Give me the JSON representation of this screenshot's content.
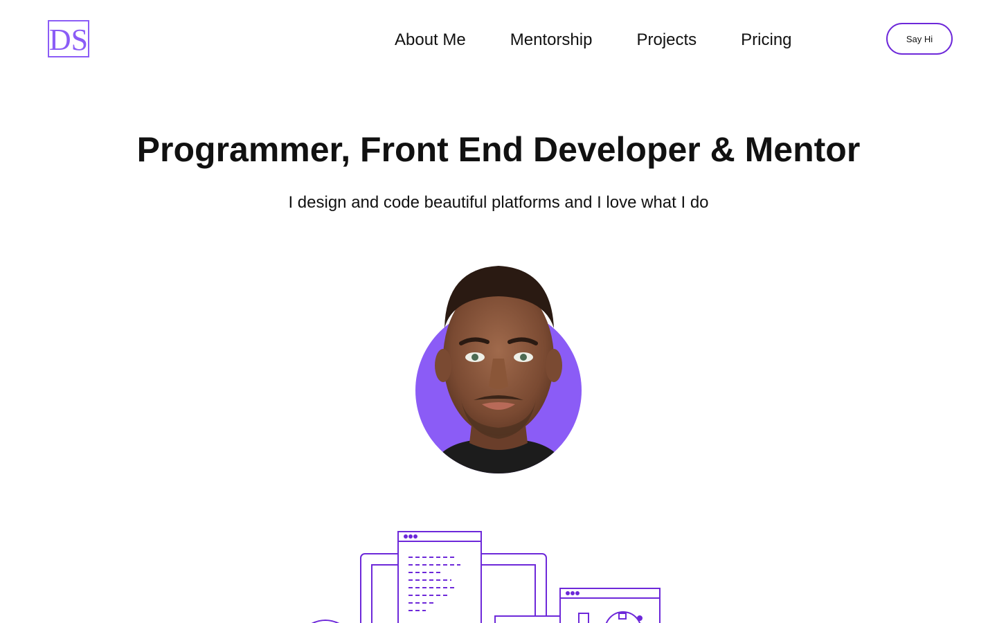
{
  "logo": {
    "text": "DS",
    "color": "#8b5cf6"
  },
  "nav": {
    "items": [
      {
        "label": "About Me"
      },
      {
        "label": "Mentorship"
      },
      {
        "label": "Projects"
      },
      {
        "label": "Pricing"
      }
    ],
    "cta_label": "Say Hi"
  },
  "hero": {
    "title": "Programmer, Front End Developer & Mentor",
    "subtitle": "I design and code beautiful platforms and I love what I do"
  },
  "colors": {
    "accent": "#8b5cf6",
    "accent_dark": "#6d28d9",
    "text": "#111111",
    "background": "#ffffff"
  },
  "icons": {
    "avatar": "avatar-portrait",
    "illustration": "devices-code-illustration"
  }
}
